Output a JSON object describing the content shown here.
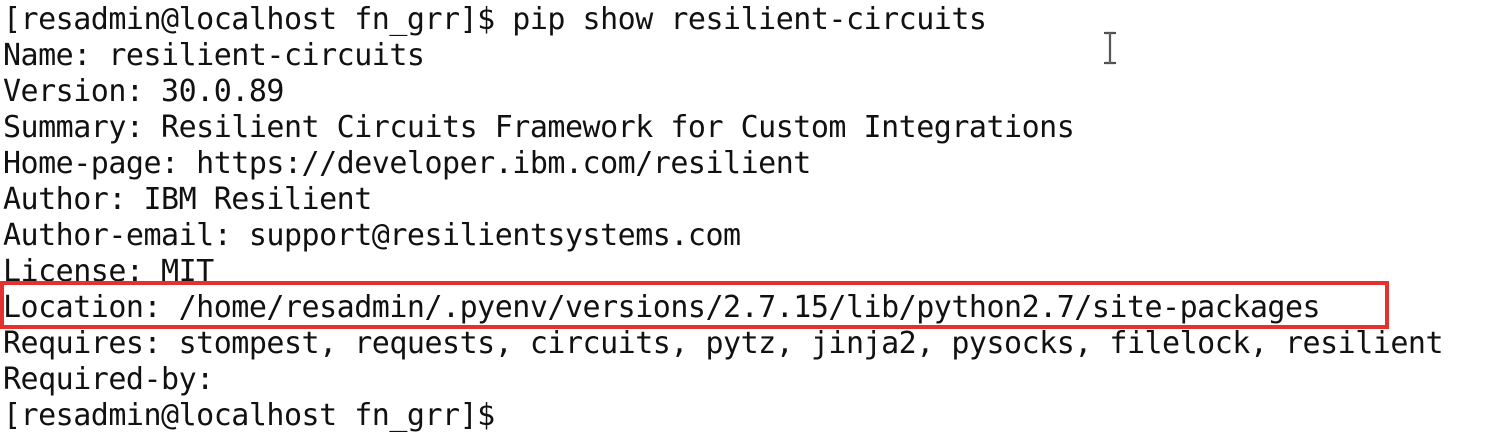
{
  "terminal": {
    "lines": [
      "[resadmin@localhost fn_grr]$ pip show resilient-circuits",
      "Name: resilient-circuits",
      "Version: 30.0.89",
      "Summary: Resilient Circuits Framework for Custom Integrations",
      "Home-page: https://developer.ibm.com/resilient",
      "Author: IBM Resilient",
      "Author-email: support@resilientsystems.com",
      "License: MIT",
      "Location: /home/resadmin/.pyenv/versions/2.7.15/lib/python2.7/site-packages",
      "Requires: stompest, requests, circuits, pytz, jinja2, pysocks, filelock, resilient",
      "Required-by:",
      "[resadmin@localhost fn_grr]$"
    ],
    "highlight_color": "#e5312d",
    "cursor_icon": "i-beam-cursor-icon"
  }
}
